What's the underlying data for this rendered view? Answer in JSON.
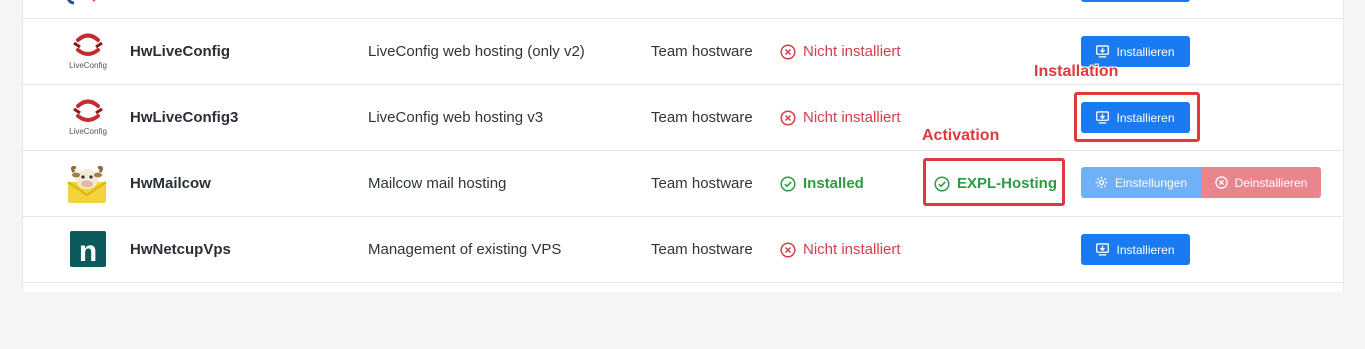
{
  "colors": {
    "primary": "#1a7af1",
    "danger": "#d2404d",
    "success": "#2e9a44",
    "annotation": "#e0383b"
  },
  "plugins": [
    {
      "name": "HwLiveConfig",
      "description": "LiveConfig web hosting (only v2)",
      "author": "Team hostware",
      "status": "Nicht installiert",
      "status_icon": "circle-x-icon",
      "logo": "liveconfig-logo",
      "logo_text": "LiveConfig",
      "action": "Installieren"
    },
    {
      "name": "HwLiveConfig3",
      "description": "LiveConfig web hosting v3",
      "author": "Team hostware",
      "status": "Nicht installiert",
      "status_icon": "circle-x-icon",
      "logo": "liveconfig-logo",
      "logo_text": "LiveConfig",
      "action": "Installieren"
    },
    {
      "name": "HwMailcow",
      "description": "Mailcow mail hosting",
      "author": "Team hostware",
      "status": "Installed",
      "status_icon": "circle-check-icon",
      "logo": "mailcow-logo",
      "activation": "EXPL-Hosting",
      "settings_label": "Einstellungen",
      "uninstall_label": "Deinstallieren"
    },
    {
      "name": "HwNetcupVps",
      "description": "Management of existing VPS",
      "author": "Team hostware",
      "status": "Nicht installiert",
      "status_icon": "circle-x-icon",
      "logo": "netcup-logo",
      "logo_text": "n",
      "action": "Installieren"
    }
  ],
  "annotations": {
    "installation": "Installation",
    "activation": "Activation"
  }
}
